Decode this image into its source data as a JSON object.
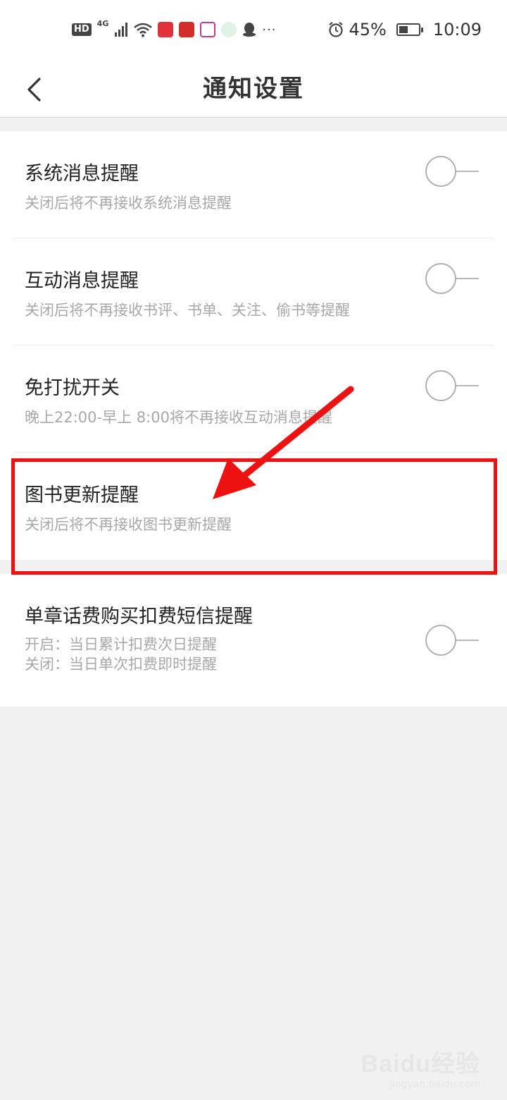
{
  "status_bar": {
    "hd": "HD",
    "network": "4G",
    "more": "···",
    "battery": "45%",
    "battery_level": 0.45,
    "time": "10:09",
    "icons": [
      "signal-icon",
      "wifi-icon",
      "reader-app-icon",
      "netease-app-icon",
      "jd-app-icon",
      "tree-app-icon",
      "qq-app-icon",
      "alarm-icon",
      "battery-icon"
    ]
  },
  "header": {
    "title": "通知设置",
    "back_icon": "chevron-left-icon"
  },
  "settings": [
    {
      "title": "系统消息提醒",
      "subtitle": "关闭后将不再接收系统消息提醒",
      "enabled": false
    },
    {
      "title": "互动消息提醒",
      "subtitle": "关闭后将不再接收书评、书单、关注、偷书等提醒",
      "enabled": false
    },
    {
      "title": "免打扰开关",
      "subtitle": "晚上22:00-早上 8:00将不再接收互动消息提醒",
      "enabled": false
    },
    {
      "title": "图书更新提醒",
      "subtitle": "关闭后将不再接收图书更新提醒"
    },
    {
      "title": "单章话费购买扣费短信提醒",
      "subtitle_lines": [
        "开启：当日累计扣费次日提醒",
        "关闭：当日单次扣费即时提醒"
      ],
      "enabled": false
    }
  ],
  "annotation": {
    "color": "#ee1111"
  },
  "watermark": {
    "main": "Baidu经验",
    "sub": "jingyan.baidu.com"
  }
}
